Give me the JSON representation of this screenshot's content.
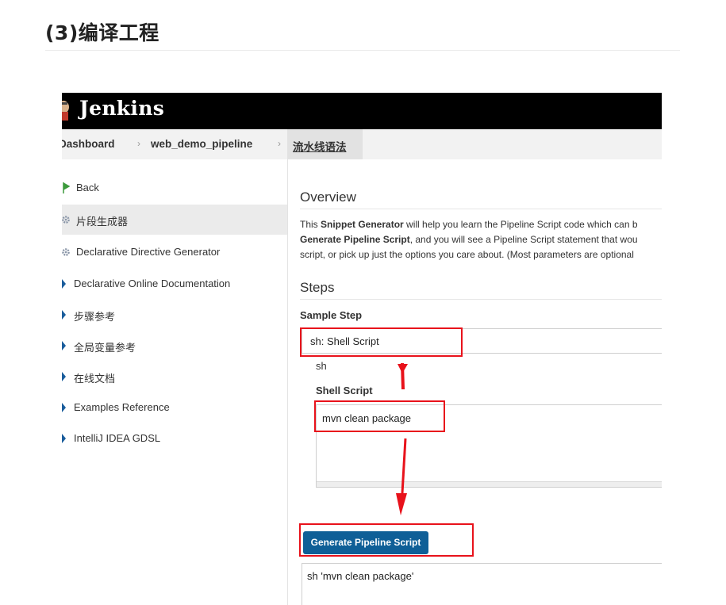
{
  "article": {
    "title": "(3)编译工程"
  },
  "jenkins": {
    "brand": "Jenkins",
    "breadcrumb": {
      "dashboard": "Dashboard",
      "job": "web_demo_pipeline",
      "current": "流水线语法"
    },
    "sidebar": {
      "items": [
        {
          "label": "Back",
          "icon": "back-arrow-icon"
        },
        {
          "label": "片段生成器",
          "icon": "gear-icon"
        },
        {
          "label": "Declarative Directive Generator",
          "icon": "gear-icon"
        },
        {
          "label": "Declarative Online Documentation",
          "icon": "chevron-right-icon"
        },
        {
          "label": "步骤参考",
          "icon": "chevron-right-icon"
        },
        {
          "label": "全局变量参考",
          "icon": "chevron-right-icon"
        },
        {
          "label": "在线文档",
          "icon": "chevron-right-icon"
        },
        {
          "label": "Examples Reference",
          "icon": "chevron-right-icon"
        },
        {
          "label": "IntelliJ IDEA GDSL",
          "icon": "chevron-right-icon"
        }
      ]
    },
    "main": {
      "overview_heading": "Overview",
      "overview_line1_pre": "This ",
      "overview_line1_bold": "Snippet Generator",
      "overview_line1_post": " will help you learn the Pipeline Script code which can b",
      "overview_line2_bold": "Generate Pipeline Script",
      "overview_line2_post": ", and you will see a Pipeline Script statement that wou",
      "overview_line3": "script, or pick up just the options you care about. (Most parameters are optional",
      "steps_heading": "Steps",
      "sample_step_label": "Sample Step",
      "sample_step_value": "sh: Shell Script",
      "step_name": "sh",
      "shell_script_label": "Shell Script",
      "shell_script_value": "mvn clean package",
      "generate_button": "Generate Pipeline Script",
      "output_value": "sh 'mvn clean package'"
    },
    "colors": {
      "topbar": "#000000",
      "button": "#0f5f97",
      "annotation": "#e8121b"
    }
  }
}
